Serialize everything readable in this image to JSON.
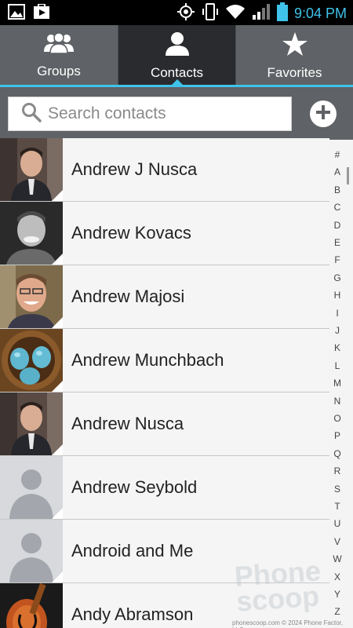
{
  "status_bar": {
    "time": "9:04 PM",
    "accent_color": "#3fc3ea",
    "icons": [
      "image-notification-icon",
      "play-store-icon",
      "location-icon",
      "vibrate-icon",
      "wifi-icon",
      "signal-icon",
      "battery-icon"
    ]
  },
  "tabs": [
    {
      "label": "Groups",
      "icon": "groups-icon",
      "active": false
    },
    {
      "label": "Contacts",
      "icon": "person-icon",
      "active": true
    },
    {
      "label": "Favorites",
      "icon": "star-icon",
      "active": false
    }
  ],
  "search": {
    "placeholder": "Search contacts",
    "value": ""
  },
  "contacts": [
    {
      "name": "Andrew J Nusca",
      "avatar": "photo"
    },
    {
      "name": "Andrew Kovacs",
      "avatar": "photo"
    },
    {
      "name": "Andrew Majosi",
      "avatar": "photo"
    },
    {
      "name": "Andrew Munchbach",
      "avatar": "photo-eggs"
    },
    {
      "name": "Andrew Nusca",
      "avatar": "photo"
    },
    {
      "name": "Andrew Seybold",
      "avatar": "default-silhouette"
    },
    {
      "name": "Android and Me",
      "avatar": "default-silhouette"
    },
    {
      "name": "Andy Abramson",
      "avatar": "photo-guitar"
    }
  ],
  "index_letters": [
    "#",
    "A",
    "B",
    "C",
    "D",
    "E",
    "F",
    "G",
    "H",
    "I",
    "J",
    "K",
    "L",
    "M",
    "N",
    "O",
    "P",
    "Q",
    "R",
    "S",
    "T",
    "U",
    "V",
    "W",
    "X",
    "Y",
    "Z"
  ],
  "watermark": {
    "line1": "Phone",
    "line2": "scoop"
  },
  "credit": "phonescoop.com  © 2024 Phone Factor, LLC"
}
